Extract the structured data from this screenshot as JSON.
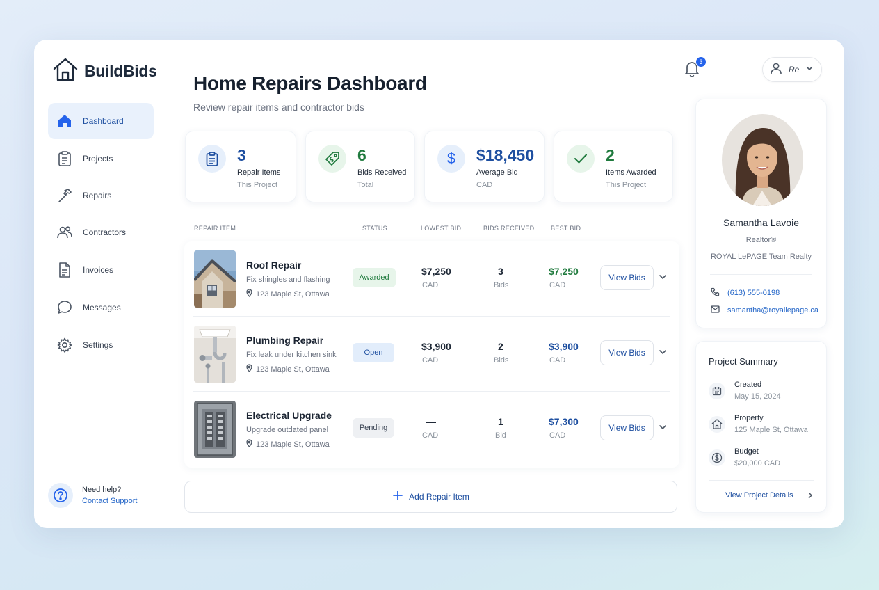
{
  "app": {
    "brand": "BuildBids"
  },
  "sidebar": {
    "items": [
      {
        "label": "Dashboard",
        "icon": "home-icon",
        "active": true
      },
      {
        "label": "Projects",
        "icon": "clipboard-icon"
      },
      {
        "label": "Repairs",
        "icon": "hammer-icon"
      },
      {
        "label": "Contractors",
        "icon": "users-icon"
      },
      {
        "label": "Invoices",
        "icon": "document-icon"
      },
      {
        "label": "Messages",
        "icon": "chat-icon"
      },
      {
        "label": "Settings",
        "icon": "gear-icon"
      }
    ],
    "help": {
      "title": "Need help?",
      "link": "Contact Support"
    }
  },
  "header": {
    "title": "Home Repairs Dashboard",
    "subtitle": "Review repair items and contractor bids",
    "notifications": "3",
    "user_label": "Re"
  },
  "stats": [
    {
      "value": "3",
      "label": "Repair Items",
      "sub": "This Project",
      "icon": "clipboard-icon",
      "color": "#1e4fa0"
    },
    {
      "value": "6",
      "label": "Bids Received",
      "sub": "Total",
      "icon": "tag-icon",
      "color": "#1f7a3d"
    },
    {
      "value": "$18,450",
      "label": "Average Bid",
      "sub": "CAD",
      "icon": "dollar-icon",
      "color": "#1e4fa0"
    },
    {
      "value": "2",
      "label": "Items Awarded",
      "sub": "This Project",
      "icon": "check-icon",
      "color": "#1f7a3d"
    }
  ],
  "table": {
    "headers": {
      "item": "REPAIR ITEM",
      "status": "STATUS",
      "lowest": "LOWEST BID",
      "bids": "BIDS RECEIVED",
      "best": "BEST BID"
    },
    "view_label": "View Bids",
    "rows": [
      {
        "name": "Roof Repair",
        "desc": "Fix shingles and flashing",
        "location": "123 Maple St, Ottawa",
        "status": "Awarded",
        "lowest": "$7,250",
        "lowest_unit": "CAD",
        "bids": "3",
        "bids_unit": "Bids",
        "best": "$7,250",
        "best_unit": "CAD"
      },
      {
        "name": "Plumbing Repair",
        "desc": "Fix leak under kitchen sink",
        "location": "123 Maple St, Ottawa",
        "status": "Open",
        "lowest": "$3,900",
        "lowest_unit": "CAD",
        "bids": "2",
        "bids_unit": "Bids",
        "best": "$3,900",
        "best_unit": "CAD"
      },
      {
        "name": "Electrical Upgrade",
        "desc": "Upgrade outdated panel",
        "location": "123 Maple St, Ottawa",
        "status": "Pending",
        "lowest": "—",
        "lowest_unit": "CAD",
        "bids": "1",
        "bids_unit": "Bid",
        "best": "$7,300",
        "best_unit": "CAD"
      }
    ],
    "add_label": "Add Repair Item"
  },
  "profile": {
    "name": "Samantha Lavoie",
    "role": "Realtor®",
    "company": "ROYAL LePAGE Team Realty",
    "phone": "(613) 555-0198",
    "email": "samantha@royallepage.ca"
  },
  "summary": {
    "title": "Project Summary",
    "items": [
      {
        "label": "Created",
        "value": "May 15, 2024",
        "icon": "calendar-icon"
      },
      {
        "label": "Property",
        "value": "125 Maple St, Ottawa",
        "icon": "house-icon"
      },
      {
        "label": "Budget",
        "value": "$20,000 CAD",
        "icon": "dollar-icon"
      }
    ],
    "link": "View Project Details"
  },
  "colors": {
    "accent": "#1e4fa0",
    "success": "#1f7a3d",
    "link": "#2466c8"
  }
}
